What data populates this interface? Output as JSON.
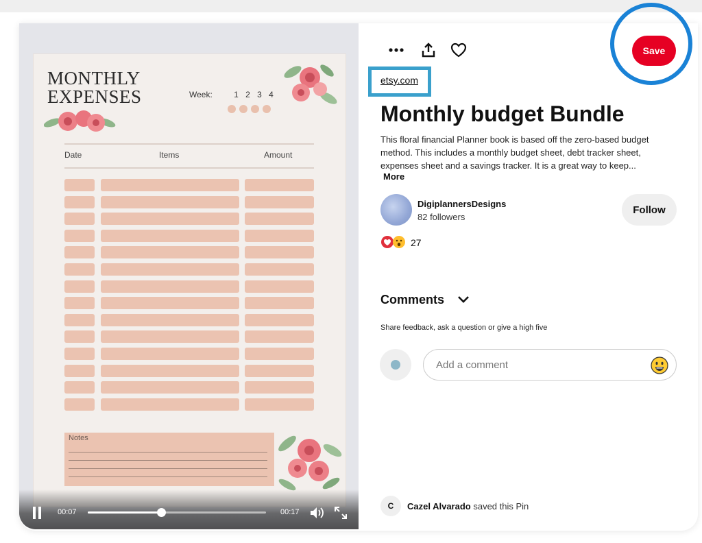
{
  "pin": {
    "sheet": {
      "title": "MONTHLY EXPENSES",
      "week_label": "Week:",
      "week_numbers": [
        "1",
        "2",
        "3",
        "4"
      ],
      "columns": {
        "date": "Date",
        "items": "Items",
        "amount": "Amount"
      },
      "notes_label": "Notes"
    },
    "video": {
      "current_time": "00:07",
      "total_time": "00:17",
      "progress_percent": 41
    }
  },
  "actions": {
    "save_label": "Save",
    "icons": [
      "more-icon",
      "share-icon",
      "heart-icon"
    ]
  },
  "link": "etsy.com",
  "title": "Monthly budget Bundle",
  "description": "This floral financial Planner book is based off the zero-based budget method. This includes a monthly budget sheet, debt tracker sheet, expenses sheet and a savings tracker. It is a great way to keep...",
  "more_label": "More",
  "creator": {
    "name": "DigiplannersDesigns",
    "followers": "82 followers",
    "follow_label": "Follow"
  },
  "reactions": {
    "count": "27"
  },
  "comments": {
    "heading": "Comments",
    "prompt": "Share feedback, ask a question or give a high five",
    "placeholder": "Add a comment",
    "avatar_initial": "C",
    "saved_by": "Cazel Alvarado",
    "saved_text": " saved this Pin"
  },
  "colors": {
    "save": "#e60023",
    "highlight": "#1a82d6",
    "link_box": "#3aa0cc",
    "sheet_cell": "#ebc3b1"
  }
}
